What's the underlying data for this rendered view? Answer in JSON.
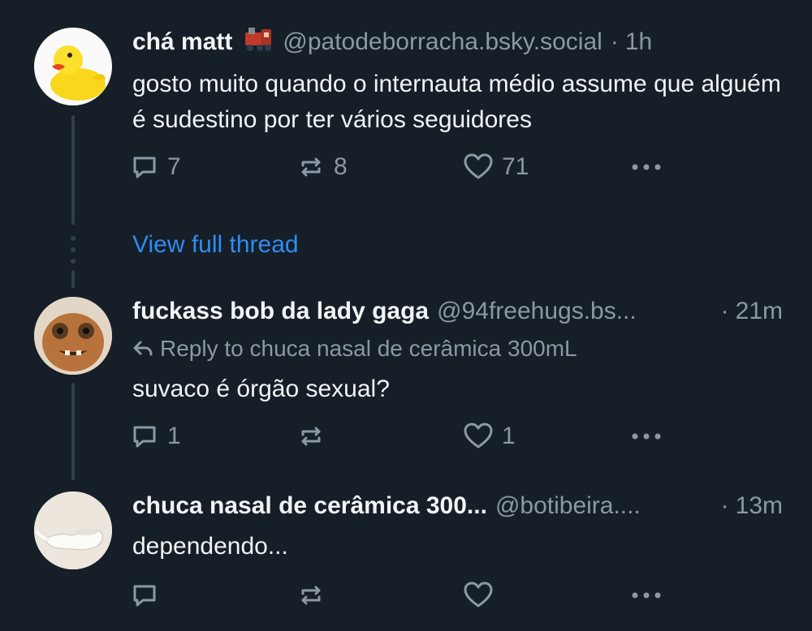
{
  "posts": [
    {
      "author": "chá matt",
      "handle": "@patodeborracha.bsky.social",
      "separator": "·",
      "time": "1h",
      "text": "gosto muito quando o internauta médio assume que alguém é sudestino por ter vários seguidores",
      "reply_count": "7",
      "repost_count": "8",
      "like_count": "71",
      "avatar_icon": "rubber-duck-avatar",
      "name_emoji_icon": "train-icon"
    },
    {
      "author": "fuckass bob da lady gaga",
      "handle": "@94freehugs.bs...",
      "separator": "·",
      "time": "21m",
      "reply_to": "Reply to chuca nasal de cerâmica 300mL",
      "text": "suvaco é órgão sexual?",
      "reply_count": "1",
      "repost_count": "",
      "like_count": "1",
      "avatar_icon": "dinosaur-baby-avatar"
    },
    {
      "author": "chuca nasal de cerâmica 300...",
      "handle": "@botibeira....",
      "separator": "·",
      "time": "13m",
      "text": "dependendo...",
      "reply_count": "",
      "repost_count": "",
      "like_count": "",
      "avatar_icon": "neti-pot-avatar"
    }
  ],
  "view_full_thread": "View full thread",
  "colors": {
    "background": "#161e27",
    "text": "#f1f3f5",
    "muted": "#8b98a5",
    "link": "#2f8cf5",
    "thread_line": "#2e4052"
  }
}
